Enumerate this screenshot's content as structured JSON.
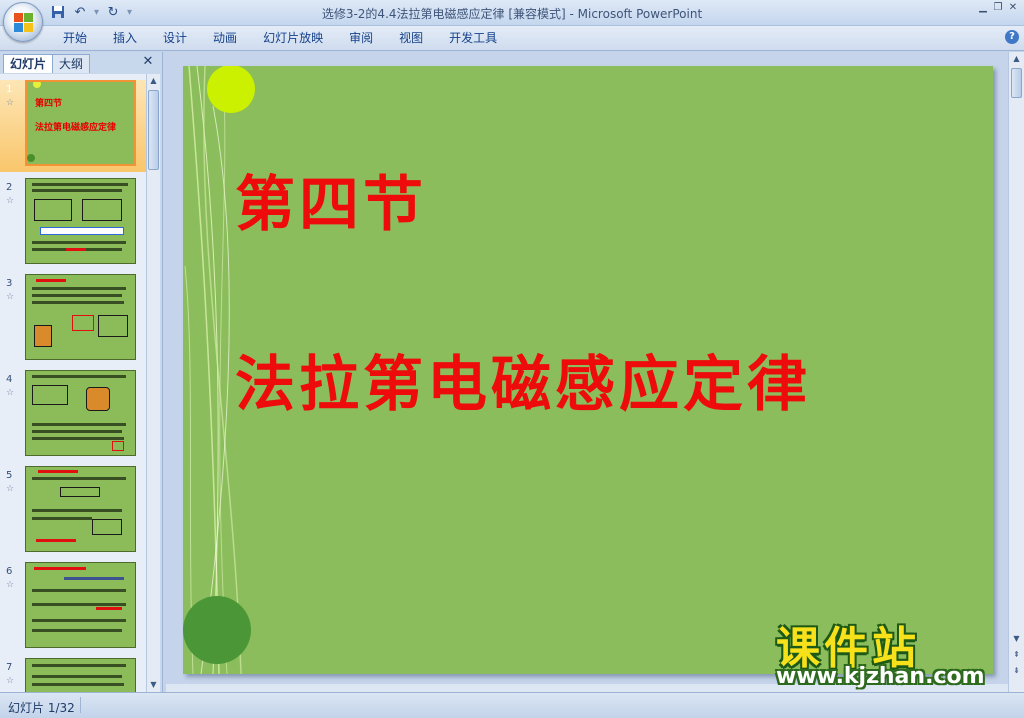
{
  "window": {
    "title": "选修3-2的4.4法拉第电磁感应定律 [兼容模式] - Microsoft PowerPoint"
  },
  "quick_access": {
    "save_icon": "save-icon",
    "undo_icon": "undo-icon",
    "redo_icon": "redo-icon",
    "customize_icon": "dropdown-arrow-icon",
    "undo_glyph": "↶",
    "redo_glyph": "↻",
    "customize_glyph": "▾"
  },
  "window_controls": {
    "minimize": "▁",
    "restore": "❐",
    "close": "✕"
  },
  "ribbon": {
    "tabs": [
      "开始",
      "插入",
      "设计",
      "动画",
      "幻灯片放映",
      "审阅",
      "视图",
      "开发工具"
    ],
    "help": "?"
  },
  "left_panel": {
    "tabs": [
      "幻灯片",
      "大纲"
    ],
    "close": "✕",
    "star": "☆",
    "scroll_up": "▲",
    "scroll_down": "▼",
    "thumbnails": [
      {
        "number": "1",
        "title1": "第四节",
        "title2": "法拉第电磁感应定律"
      },
      {
        "number": "2"
      },
      {
        "number": "3"
      },
      {
        "number": "4"
      },
      {
        "number": "5"
      },
      {
        "number": "6"
      },
      {
        "number": "7"
      }
    ]
  },
  "slide": {
    "title_line1": "第四节",
    "title_line2": "法拉第电磁感应定律",
    "colors": {
      "background": "#8bbd5c",
      "title": "#ee0b0b",
      "yellow_circle": "#cbf000",
      "green_circle": "#4b9637"
    }
  },
  "watermark": {
    "brand": "课件站",
    "url": "www.kjzhan.com"
  },
  "status": {
    "slide_counter": "幻灯片 1/32"
  },
  "main_scroll": {
    "up": "▲",
    "down": "▼",
    "prev": "⇞",
    "next": "⇟"
  }
}
